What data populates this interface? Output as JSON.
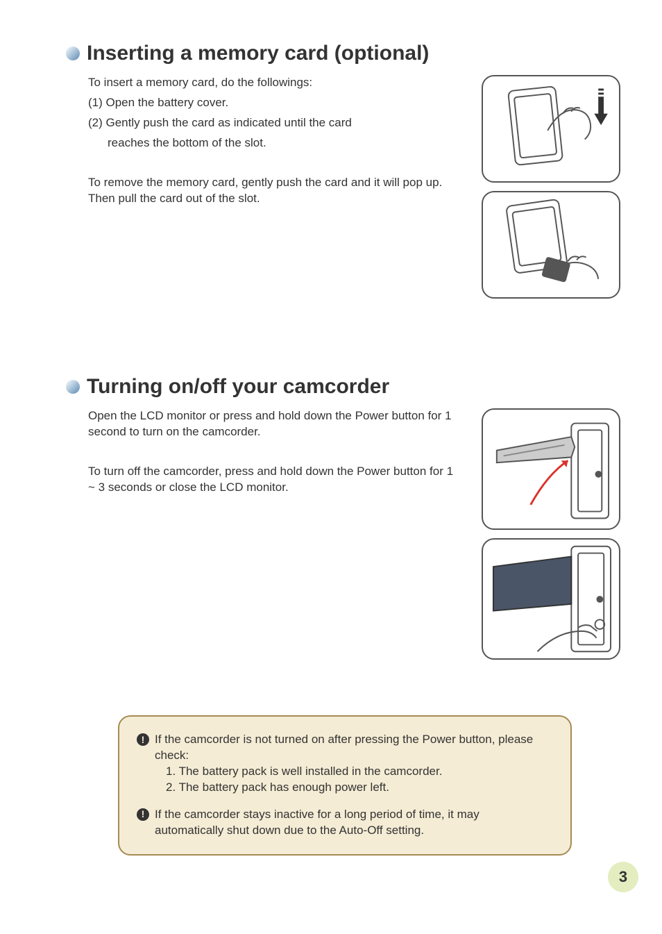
{
  "section1": {
    "title": "Inserting a memory card (optional)",
    "intro": "To insert a memory card, do the followings:",
    "step1": "(1) Open the battery cover.",
    "step2a": "(2) Gently push the card as indicated until the card",
    "step2b": "reaches the bottom of the slot.",
    "remove": "To remove the memory card, gently push the card and it will pop up. Then pull the card out of the slot."
  },
  "section2": {
    "title": "Turning on/off your camcorder",
    "on": "Open the LCD monitor or press and hold down the Power button for 1 second to turn on the camcorder.",
    "off": "To turn off the camcorder, press and hold down the Power button for 1 ~ 3 seconds or close the LCD monitor."
  },
  "notes": {
    "n1_intro": "If the camcorder is not turned on after pressing the Power button, please check:",
    "n1_1": "1. The battery pack is well installed in the camcorder.",
    "n1_2": "2. The battery pack has enough power left.",
    "n2": "If the camcorder stays inactive for a long period of time, it may automatically shut down due to the Auto-Off setting."
  },
  "page_number": "3"
}
